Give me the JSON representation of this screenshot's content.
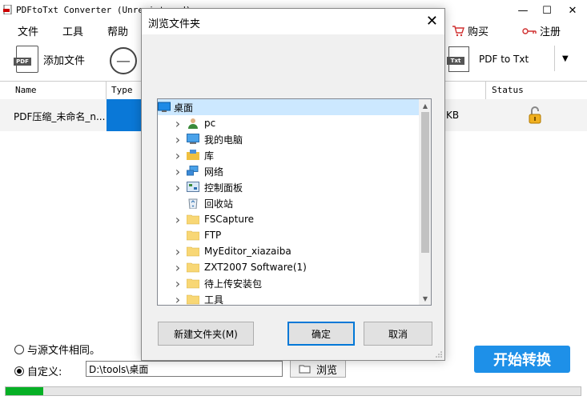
{
  "app": {
    "title": "PDFtoTxt Converter (Unregistered)",
    "menu": [
      "文件",
      "工具",
      "帮助"
    ],
    "buy_label": "购买",
    "register_label": "注册"
  },
  "toolbar": {
    "add_file_label": "添加文件",
    "pdf_badge": "PDF",
    "txt_badge": "Txt",
    "convert_label": "PDF to Txt"
  },
  "table": {
    "headers": [
      "Name",
      "Type",
      "Status"
    ],
    "rows": [
      {
        "name": "PDF压缩_未命名_n...",
        "size_suffix": "KB"
      }
    ]
  },
  "output": {
    "same_as_source_label": "与源文件相同。",
    "custom_label": "自定义:",
    "custom_path": "D:\\tools\\桌面",
    "browse_label": "浏览",
    "selected_option": "custom"
  },
  "start_button_label": "开始转换",
  "progress_fraction": 0.065,
  "dialog": {
    "title": "浏览文件夹",
    "tree": [
      {
        "label": "桌面",
        "icon": "desktop-icon",
        "level": 0,
        "expandable": false,
        "selected": true
      },
      {
        "label": "pc",
        "icon": "user-icon",
        "level": 1,
        "expandable": true
      },
      {
        "label": "我的电脑",
        "icon": "computer-icon",
        "level": 1,
        "expandable": true
      },
      {
        "label": "库",
        "icon": "library-icon",
        "level": 1,
        "expandable": true
      },
      {
        "label": "网络",
        "icon": "network-icon",
        "level": 1,
        "expandable": true
      },
      {
        "label": "控制面板",
        "icon": "control-panel-icon",
        "level": 1,
        "expandable": true
      },
      {
        "label": "回收站",
        "icon": "recycle-bin-icon",
        "level": 1,
        "expandable": false
      },
      {
        "label": "FSCapture",
        "icon": "folder-icon",
        "level": 1,
        "expandable": true
      },
      {
        "label": "FTP",
        "icon": "folder-icon",
        "level": 1,
        "expandable": false
      },
      {
        "label": "MyEditor_xiazaiba",
        "icon": "folder-icon",
        "level": 1,
        "expandable": true
      },
      {
        "label": "ZXT2007 Software(1)",
        "icon": "folder-icon",
        "level": 1,
        "expandable": true
      },
      {
        "label": "待上传安装包",
        "icon": "folder-icon",
        "level": 1,
        "expandable": true
      },
      {
        "label": "工具",
        "icon": "folder-icon",
        "level": 1,
        "expandable": true
      }
    ],
    "new_folder_label": "新建文件夹(M)",
    "ok_label": "确定",
    "cancel_label": "取消"
  }
}
